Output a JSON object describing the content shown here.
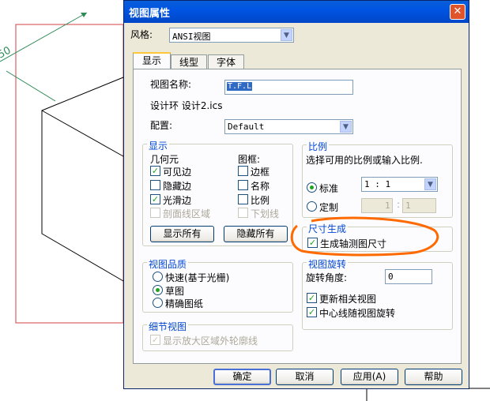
{
  "dialog": {
    "title": "视图属性",
    "close_symbol": "✕",
    "style_label": "风格:",
    "style_value": "ANSI视图"
  },
  "tabs": [
    {
      "label": "显示",
      "active": true
    },
    {
      "label": "线型",
      "active": false
    },
    {
      "label": "字体",
      "active": false
    }
  ],
  "view_name": {
    "label": "视图名称:",
    "value": "T.F.L"
  },
  "design_env": {
    "text": "设计环 设计2.ics"
  },
  "config": {
    "label": "配置:",
    "value": "Default"
  },
  "display_group": {
    "title": "显示",
    "geometry_header": "几何元",
    "frame_header": "图框:",
    "visible_edges": {
      "label": "可见边",
      "checked": true
    },
    "hidden_edges": {
      "label": "隐藏边",
      "checked": false
    },
    "smooth_edges": {
      "label": "光滑边",
      "checked": true
    },
    "section_region": {
      "label": "剖面线区域",
      "checked": false
    },
    "border": {
      "label": "边框",
      "checked": false
    },
    "name": {
      "label": "名称",
      "checked": false
    },
    "scale": {
      "label": "比例",
      "checked": false
    },
    "underline": {
      "label": "下划线",
      "checked": false
    },
    "show_all_button": "显示所有",
    "hide_all_button": "隐藏所有"
  },
  "scale_group": {
    "title": "比例",
    "hint": "选择可用的比例或输入比例.",
    "standard_label": "标准",
    "standard_value": "1 : 1",
    "custom_label": "定制",
    "custom_left": "1",
    "custom_sep": ":",
    "custom_right": "1"
  },
  "dimension_group": {
    "title": "尺寸生成",
    "axis_dims": {
      "label": "生成轴测图尺寸",
      "checked": true
    }
  },
  "quality_group": {
    "title": "视图品质",
    "fast": "快速(基于光栅)",
    "draft": "草图",
    "precise": "精确图纸"
  },
  "rotation_group": {
    "title": "视图旋转",
    "angle_label": "旋转角度:",
    "angle_value": "0",
    "update_related": {
      "label": "更新相关视图",
      "checked": true
    },
    "centerline_rotate": {
      "label": "中心线随视图旋转",
      "checked": true
    }
  },
  "detail_group": {
    "title": "细节视图",
    "show_outline": {
      "label": "显示放大区域外轮廓线",
      "checked": true
    }
  },
  "footer": {
    "ok": "确定",
    "cancel": "取消",
    "apply": "应用(A)",
    "help": "帮助"
  },
  "background": {
    "dimension_text": "50"
  },
  "colors": {
    "title_blue": "#0054e3",
    "group_title": "#0046d5",
    "highlight": "#ff6a00"
  }
}
